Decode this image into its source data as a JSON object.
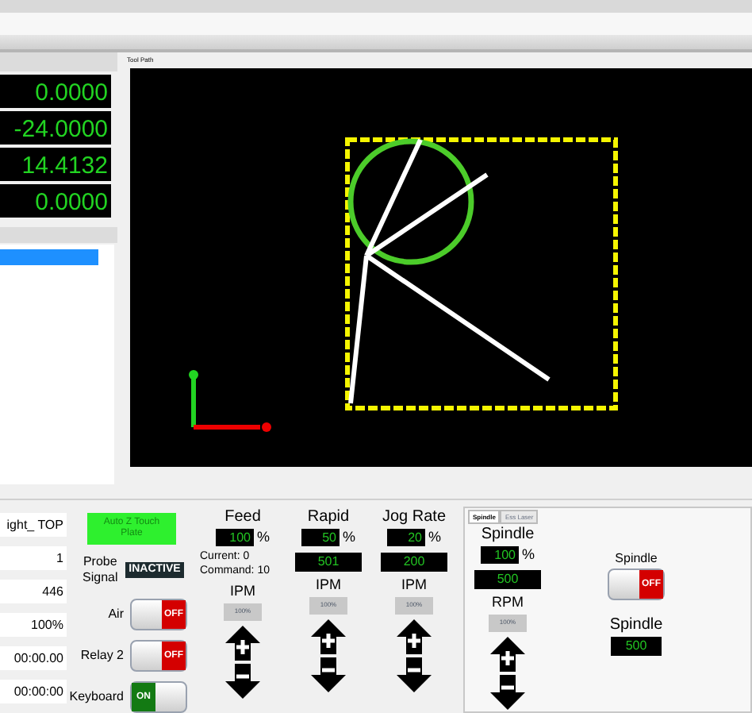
{
  "dro": [
    "0.0000",
    "-24.0000",
    "14.4132",
    "0.0000"
  ],
  "file_list": {
    "items": [
      {
        "selected": true
      }
    ]
  },
  "tool_path": {
    "title": "Tool Path"
  },
  "status_fields": [
    "ight_ TOP",
    "1",
    "446",
    "100%",
    "00:00.00",
    "00:00:00"
  ],
  "touch_plate_button": "Auto Z Touch Plate",
  "probe": {
    "label": "Probe Signal",
    "status": "INACTIVE",
    "active": false
  },
  "toggles": [
    {
      "label": "Air",
      "on": false,
      "text": "OFF"
    },
    {
      "label": "Relay 2",
      "on": false,
      "text": "OFF"
    },
    {
      "label": "Keyboard",
      "on": true,
      "text": "ON"
    }
  ],
  "overrides": [
    {
      "kind": "feed",
      "title": "Feed",
      "percent": "100",
      "unit": "%",
      "current_label": "Current:",
      "current": "0",
      "command_label": "Command:",
      "command": "10",
      "rate_label": "IPM",
      "reset": "100%"
    },
    {
      "kind": "rate",
      "title": "Rapid",
      "percent": "50",
      "unit": "%",
      "value": "501",
      "rate_label": "IPM",
      "reset": "100%"
    },
    {
      "kind": "rate",
      "title": "Jog Rate",
      "percent": "20",
      "unit": "%",
      "value": "200",
      "rate_label": "IPM",
      "reset": "100%"
    }
  ],
  "spindle_panel": {
    "tabs": [
      {
        "label": "Spindle",
        "selected": true
      },
      {
        "label": "Ess Laser",
        "selected": false
      }
    ],
    "override": {
      "title": "Spindle",
      "percent": "100",
      "unit": "%",
      "value": "500",
      "rate_label": "RPM",
      "reset": "100%"
    },
    "toggle": {
      "label": "Spindle",
      "on": false,
      "text": "OFF"
    },
    "speed": {
      "label": "Spindle",
      "value": "500"
    }
  }
}
